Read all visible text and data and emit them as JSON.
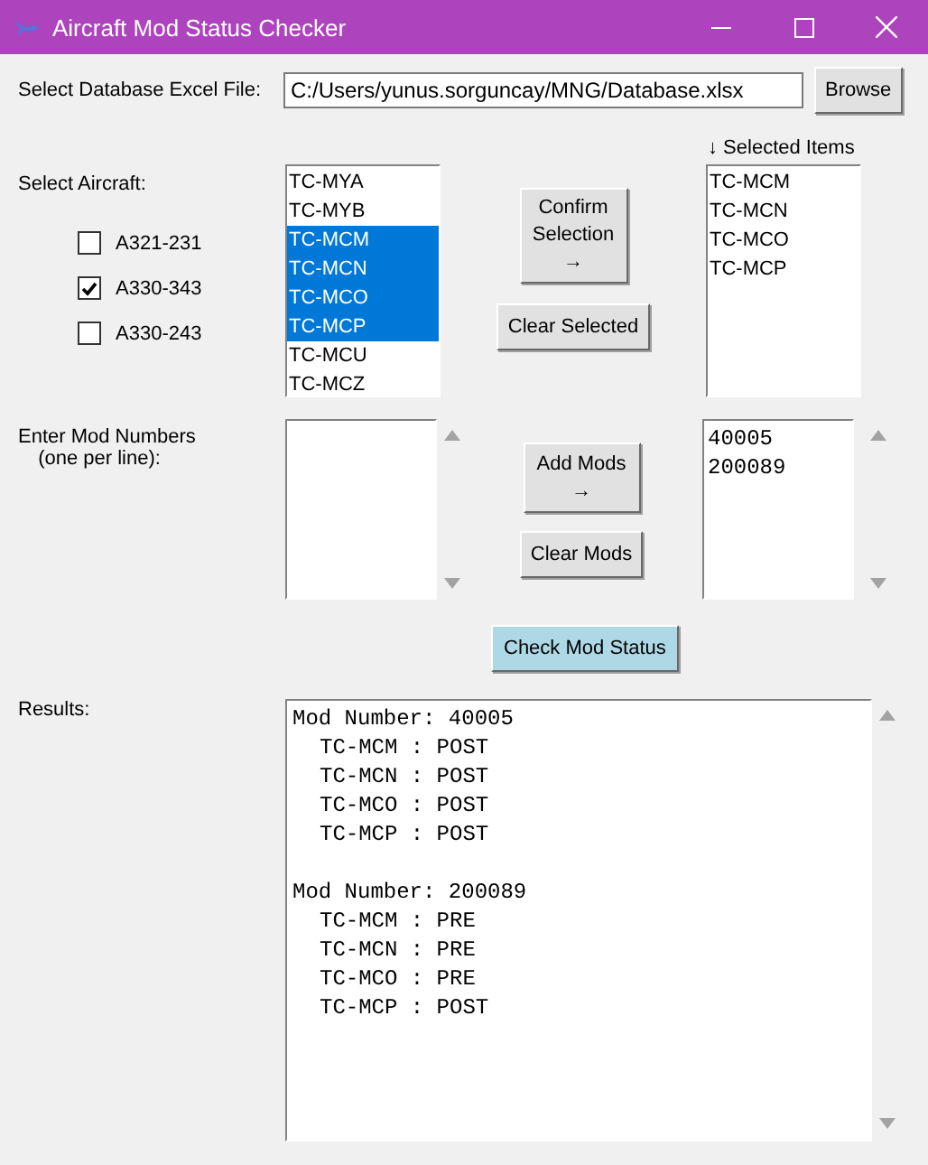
{
  "window": {
    "title": "Aircraft Mod Status Checker"
  },
  "database": {
    "label": "Select Database Excel File:",
    "value": "C:/Users/yunus.sorguncay/MNG/Database.xlsx",
    "browse": "Browse"
  },
  "selected_header": "↓ Selected Items",
  "aircraft": {
    "label": "Select Aircraft:",
    "types": [
      {
        "label": "A321-231",
        "checked": false
      },
      {
        "label": "A330-343",
        "checked": true
      },
      {
        "label": "A330-243",
        "checked": false
      }
    ],
    "registrations": [
      {
        "label": "TC-MYA",
        "selected": false
      },
      {
        "label": "TC-MYB",
        "selected": false
      },
      {
        "label": "TC-MCM",
        "selected": true
      },
      {
        "label": "TC-MCN",
        "selected": true
      },
      {
        "label": "TC-MCO",
        "selected": true
      },
      {
        "label": "TC-MCP",
        "selected": true
      },
      {
        "label": "TC-MCU",
        "selected": false
      },
      {
        "label": "TC-MCZ",
        "selected": false
      }
    ],
    "confirm_button": {
      "label": "Confirm Selection",
      "arrow": "→"
    },
    "clear_button": "Clear Selected",
    "selected_items": [
      "TC-MCM",
      "TC-MCN",
      "TC-MCO",
      "TC-MCP"
    ]
  },
  "mods": {
    "label": "Enter Mod Numbers",
    "sublabel": "(one per line):",
    "add_button": {
      "label": "Add Mods",
      "arrow": "→"
    },
    "clear_button": "Clear Mods",
    "added": [
      "40005",
      "200089"
    ]
  },
  "check_button": "Check Mod Status",
  "results": {
    "label": "Results:",
    "groups": [
      {
        "heading": "Mod Number: 40005",
        "lines": [
          "TC-MCM : POST",
          "TC-MCN : POST",
          "TC-MCO : POST",
          "TC-MCP : POST"
        ]
      },
      {
        "heading": "Mod Number: 200089",
        "lines": [
          "TC-MCM : PRE",
          "TC-MCN : PRE",
          "TC-MCO : PRE",
          "TC-MCP : POST"
        ]
      }
    ]
  }
}
